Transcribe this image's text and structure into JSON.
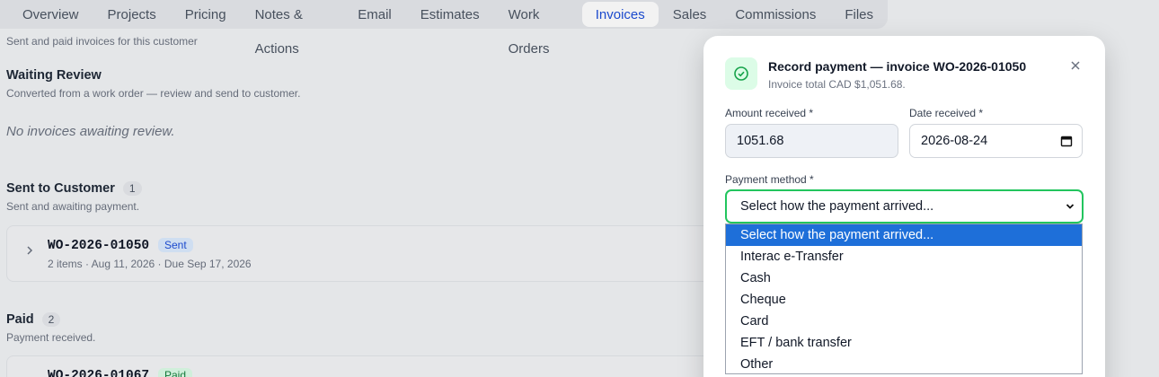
{
  "tabs": [
    "Overview",
    "Projects",
    "Pricing",
    "Notes & Actions",
    "Email",
    "Estimates",
    "Work Orders",
    "Invoices",
    "Sales",
    "Commissions",
    "Files"
  ],
  "active_tab": "Invoices",
  "page": {
    "subtitle": "Sent and paid invoices for this customer",
    "waiting": {
      "title": "Waiting Review",
      "desc": "Converted from a work order — review and send to customer.",
      "empty": "No invoices awaiting review."
    },
    "sent": {
      "title": "Sent to Customer",
      "count": "1",
      "desc": "Sent and awaiting payment.",
      "invoice": {
        "id": "WO-2026-01050",
        "badge": "Sent",
        "meta": "2 items · Aug 11, 2026 · Due Sep 17, 2026"
      }
    },
    "paid": {
      "title": "Paid",
      "count": "2",
      "desc": "Payment received.",
      "invoice": {
        "id": "WO-2026-01067",
        "badge": "Paid"
      }
    }
  },
  "modal": {
    "title": "Record payment — invoice WO-2026-01050",
    "subtitle": "Invoice total CAD $1,051.68.",
    "amount_label": "Amount received *",
    "amount_value": "1051.68",
    "date_label": "Date received *",
    "date_value": "2026-08-24",
    "method_label": "Payment method *",
    "method_value": "Select how the payment arrived...",
    "options": [
      "Select how the payment arrived...",
      "Interac e-Transfer",
      "Cash",
      "Cheque",
      "Card",
      "EFT / bank transfer",
      "Other"
    ]
  },
  "colors": {
    "accent": "#1d4ed8",
    "focus": "#22c55e",
    "option_highlight": "#1e6fd9"
  }
}
